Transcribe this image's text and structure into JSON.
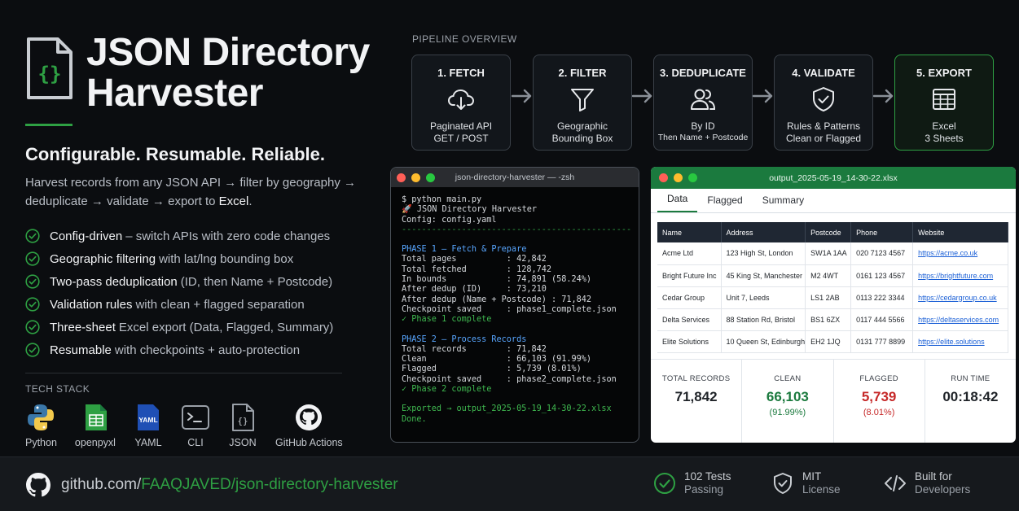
{
  "hero": {
    "title": "JSON Directory Harvester",
    "title_line1": "JSON Directory",
    "title_line2": "Harvester",
    "tagline": "Configurable. Resumable. Reliable.",
    "desc_line1": "Harvest records from any JSON API → filter by geography →",
    "desc_line2_pre": "deduplicate → validate → export to ",
    "desc_line2_strong": "Excel",
    "desc_line2_post": "."
  },
  "features": [
    {
      "strong": "Config-driven",
      "rest": "– switch APIs with zero code changes"
    },
    {
      "strong": "Geographic filtering",
      "rest": "with lat/lng bounding box"
    },
    {
      "strong": "Two-pass deduplication",
      "rest": "(ID, then Name + Postcode)"
    },
    {
      "strong": "Validation rules",
      "rest": "with clean + flagged separation"
    },
    {
      "strong": "Three-sheet",
      "rest": "Excel export (Data, Flagged, Summary)"
    },
    {
      "strong": "Resumable",
      "rest": "with checkpoints + auto-protection"
    }
  ],
  "tech_stack": {
    "label": "TECH STACK",
    "items": [
      {
        "name": "Python",
        "icon": "python-icon"
      },
      {
        "name": "openpyxl",
        "icon": "spreadsheet-icon"
      },
      {
        "name": "YAML",
        "icon": "yaml-icon",
        "badge": "YAML"
      },
      {
        "name": "CLI",
        "icon": "terminal-icon"
      },
      {
        "name": "JSON",
        "icon": "json-file-icon"
      },
      {
        "name": "GitHub Actions",
        "icon": "github-icon"
      }
    ]
  },
  "pipeline": {
    "label": "PIPELINE OVERVIEW",
    "stages": [
      {
        "title": "1. FETCH",
        "line1": "Paginated API",
        "line2": "GET / POST",
        "icon": "cloud-download-icon"
      },
      {
        "title": "2. FILTER",
        "line1": "Geographic",
        "line2": "Bounding Box",
        "icon": "filter-icon"
      },
      {
        "title": "3. DEDUPLICATE",
        "line1": "By ID",
        "line2": "Then Name + Postcode",
        "icon": "users-icon"
      },
      {
        "title": "4. VALIDATE",
        "line1": "Rules & Patterns",
        "line2": "Clean or Flagged",
        "icon": "shield-check-icon"
      },
      {
        "title": "5. EXPORT",
        "line1": "Excel",
        "line2": "3 Sheets",
        "icon": "table-icon"
      }
    ]
  },
  "terminal": {
    "title": "json-directory-harvester — -zsh",
    "cmd": "$ python main.py",
    "banner": "🚀 JSON Directory Harvester",
    "config": "Config: config.yaml",
    "rule": "----------------------------------------------",
    "phase1": {
      "heading": "PHASE 1 — Fetch & Prepare",
      "lines": [
        "Total pages          : 42,842",
        "Total fetched        : 128,742",
        "In bounds            : 74,891 (58.24%)",
        "After dedup (ID)     : 73,210",
        "After dedup (Name + Postcode) : 71,842",
        "Checkpoint saved     : phase1_complete.json"
      ],
      "done": "✓ Phase 1 complete"
    },
    "phase2": {
      "heading": "PHASE 2 — Process Records",
      "lines": [
        "Total records        : 71,842",
        "Clean                : 66,103 (91.99%)",
        "Flagged              : 5,739 (8.01%)",
        "Checkpoint saved     : phase2_complete.json"
      ],
      "done": "✓ Phase 2 complete"
    },
    "exported": "Exported → output_2025-05-19_14-30-22.xlsx",
    "final": "Done."
  },
  "excel": {
    "title": "output_2025-05-19_14-30-22.xlsx",
    "tabs": [
      "Data",
      "Flagged",
      "Summary"
    ],
    "columns": [
      "Name",
      "Address",
      "Postcode",
      "Phone",
      "Website"
    ],
    "rows": [
      [
        "Acme Ltd",
        "123 High St, London",
        "SW1A 1AA",
        "020 7123 4567",
        "https://acme.co.uk"
      ],
      [
        "Bright Future Inc",
        "45 King St, Manchester",
        "M2 4WT",
        "0161 123 4567",
        "https://brightfuture.com"
      ],
      [
        "Cedar Group",
        "Unit 7, Leeds",
        "LS1 2AB",
        "0113 222 3344",
        "https://cedargroup.co.uk"
      ],
      [
        "Delta Services",
        "88 Station Rd, Bristol",
        "BS1 6ZX",
        "0117 444 5566",
        "https://deltaservices.com"
      ],
      [
        "Elite Solutions",
        "10 Queen St, Edinburgh",
        "EH2 1JQ",
        "0131 777 8899",
        "https://elite.solutions"
      ]
    ],
    "stats": [
      {
        "label": "TOTAL RECORDS",
        "value": "71,842",
        "pct": "",
        "color": "#1f2328"
      },
      {
        "label": "CLEAN",
        "value": "66,103",
        "pct": "(91.99%)",
        "color": "#1b7a3e"
      },
      {
        "label": "FLAGGED",
        "value": "5,739",
        "pct": "(8.01%)",
        "color": "#c62828"
      },
      {
        "label": "RUN TIME",
        "value": "00:18:42",
        "pct": "",
        "color": "#1f2328"
      }
    ]
  },
  "footer": {
    "url_pre": "github.com/",
    "url_user": "FAAQJAVED",
    "url_post": "/json-directory-harvester",
    "badges": [
      {
        "line1": "102 Tests",
        "line2": "Passing",
        "icon": "check-circle-icon"
      },
      {
        "line1": "MIT",
        "line2": "License",
        "icon": "shield-icon"
      },
      {
        "line1": "Built for",
        "line2": "Developers",
        "icon": "code-icon"
      }
    ]
  },
  "colors": {
    "accent_green": "#2ea043",
    "background": "#0b0d10",
    "excel_green": "#1b7a3e",
    "flagged_red": "#c62828"
  }
}
